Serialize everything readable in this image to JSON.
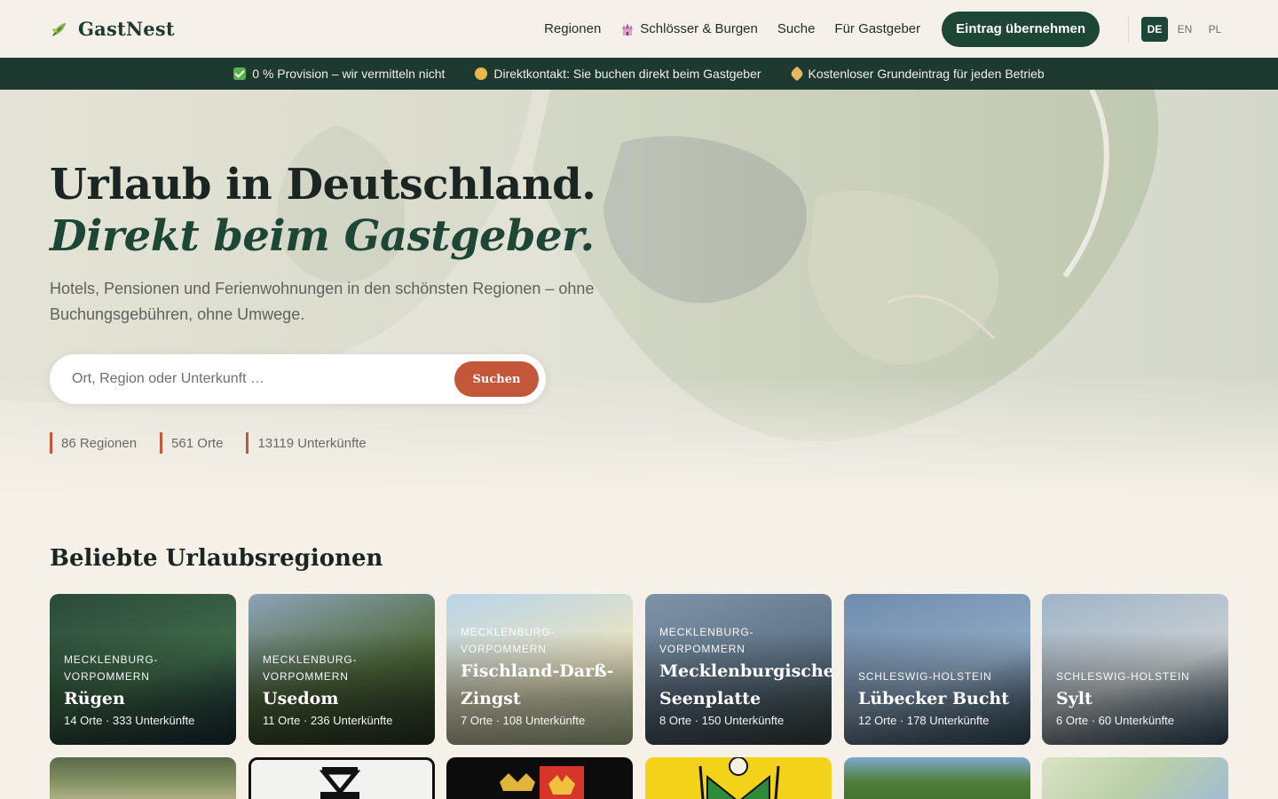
{
  "brand": {
    "name": "GastNest",
    "icon": "leaf-icon"
  },
  "nav": {
    "items": [
      {
        "label": "Regionen"
      },
      {
        "label": "Schlösser & Burgen",
        "icon": "castle-icon"
      },
      {
        "label": "Suche"
      },
      {
        "label": "Für Gastgeber"
      }
    ],
    "cta": "Eintrag übernehmen",
    "languages": [
      {
        "code": "DE",
        "active": true
      },
      {
        "code": "EN",
        "active": false
      },
      {
        "code": "PL",
        "active": false
      }
    ]
  },
  "trust_bar": [
    {
      "icon": "check-icon",
      "text": "0 % Provision – wir vermitteln nicht"
    },
    {
      "icon": "handshake-icon",
      "text": "Direktkontakt: Sie buchen direkt beim Gastgeber"
    },
    {
      "icon": "tag-icon",
      "text": "Kostenloser Grundeintrag für jeden Betrieb"
    }
  ],
  "hero": {
    "title_line1": "Urlaub in Deutschland.",
    "title_line2": "Direkt beim Gastgeber.",
    "subtitle": "Hotels, Pensionen und Ferienwohnungen in den schönsten Regionen – ohne Buchungsgebühren, ohne Umwege.",
    "search_placeholder": "Ort, Region oder Unterkunft …",
    "search_button": "Suchen",
    "stats": [
      "86 Regionen",
      "561 Orte",
      "13119 Unterkünfte"
    ]
  },
  "regions": {
    "title": "Beliebte Urlaubsregionen",
    "cards": [
      {
        "state": "Mecklenburg-Vorpommern",
        "name": "Rügen",
        "meta": "14 Orte · 333 Unterkünfte",
        "palette": [
          "#2b4a3a",
          "#3f6b4a",
          "#1d3540"
        ]
      },
      {
        "state": "Mecklenburg-Vorpommern",
        "name": "Usedom",
        "meta": "11 Orte · 236 Unterkünfte",
        "palette": [
          "#8ea3b8",
          "#4f6a3c",
          "#2f3f2a"
        ]
      },
      {
        "state": "Mecklenburg-Vorpommern",
        "name": "Fischland-Darß-Zingst",
        "meta": "7 Orte · 108 Unterkünfte",
        "palette": [
          "#b8d4e8",
          "#e9e3c4",
          "#c9d9a8"
        ]
      },
      {
        "state": "Mecklenburg-Vorpommern",
        "name": "Mecklenburgische Seenplatte",
        "meta": "8 Orte · 150 Unterkünfte",
        "palette": [
          "#7f93a8",
          "#5f7487",
          "#3e5048"
        ]
      },
      {
        "state": "Schleswig-Holstein",
        "name": "Lübecker Bucht",
        "meta": "12 Orte · 178 Unterkünfte",
        "palette": [
          "#6e8cad",
          "#8fa9c4",
          "#3e5a6b"
        ]
      },
      {
        "state": "Schleswig-Holstein",
        "name": "Sylt",
        "meta": "6 Orte · 60 Unterkünfte",
        "palette": [
          "#9fb4c8",
          "#c8cfd2",
          "#3b5a72"
        ]
      }
    ]
  }
}
